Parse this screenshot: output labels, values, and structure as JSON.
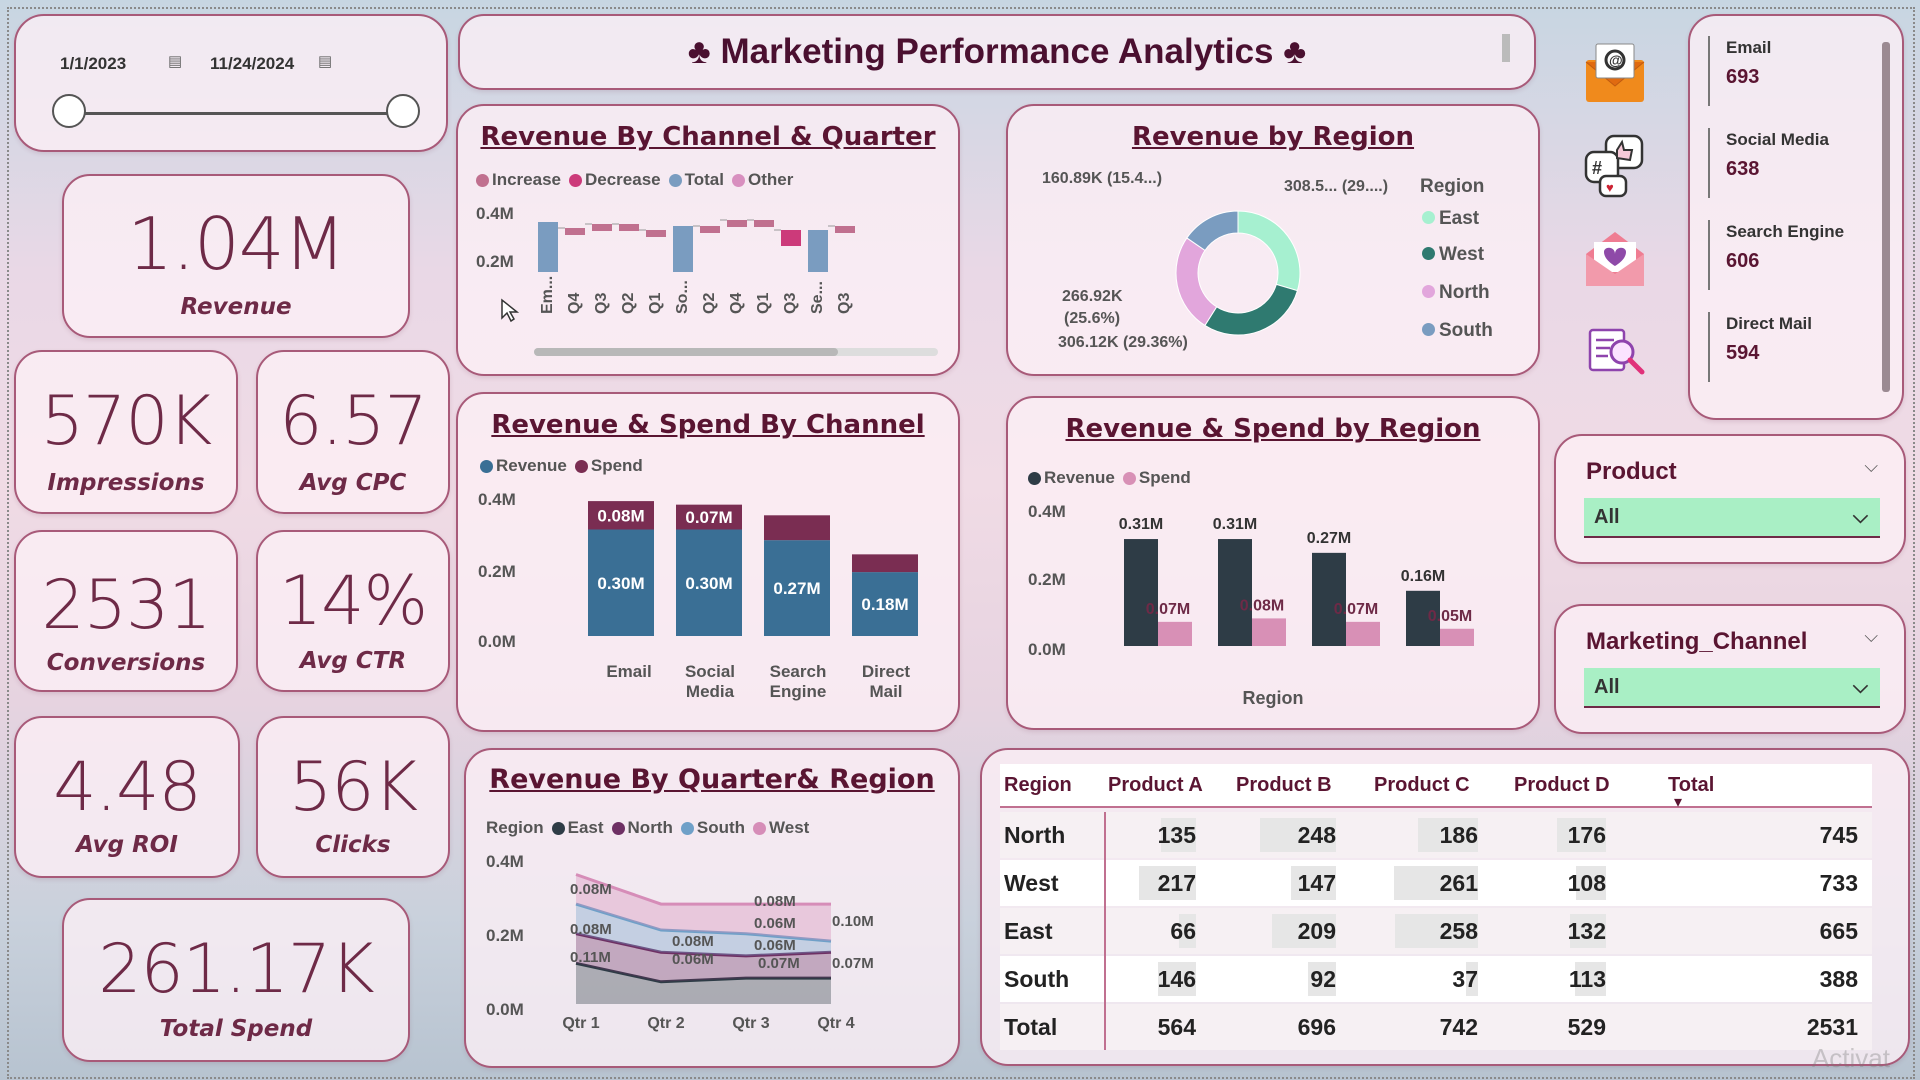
{
  "date_filter": {
    "start": "1/1/2023",
    "end": "11/24/2024"
  },
  "header": {
    "title": "♣ Marketing Performance Analytics ♣"
  },
  "kpis": {
    "revenue": {
      "value": "1.04M",
      "label": "Revenue"
    },
    "impressions": {
      "value": "570K",
      "label": "Impressions"
    },
    "avg_cpc": {
      "value": "6.57",
      "label": "Avg CPC"
    },
    "conversions": {
      "value": "2531",
      "label": "Conversions"
    },
    "avg_ctr": {
      "value": "14%",
      "label": "Avg CTR"
    },
    "avg_roi": {
      "value": "4.48",
      "label": "Avg ROI"
    },
    "clicks": {
      "value": "56K",
      "label": "Clicks"
    },
    "total_spend": {
      "value": "261.17K",
      "label": "Total Spend"
    }
  },
  "channel_counts": [
    {
      "label": "Email",
      "value": "693"
    },
    {
      "label": "Social Media",
      "value": "638"
    },
    {
      "label": "Search Engine",
      "value": "606"
    },
    {
      "label": "Direct Mail",
      "value": "594"
    }
  ],
  "icons": [
    "email-icon",
    "social-media-icon",
    "love-mail-icon",
    "search-analytics-icon"
  ],
  "filters": {
    "product": {
      "label": "Product",
      "value": "All"
    },
    "channel": {
      "label": "Marketing_Channel",
      "value": "All"
    }
  },
  "colors": {
    "revenue": "#3a6f95",
    "spend": "#7a2d52",
    "east": "#a6f0d0",
    "west": "#2f7a70",
    "north": "#e2a6dc",
    "south": "#7a9cc0",
    "increase": "#c0708f",
    "decrease": "#cc3a7a",
    "total": "#7a9cc0",
    "other": "#d88fbf",
    "qr_east": "#2e3c46",
    "qr_north": "#6e3064",
    "qr_south": "#6fa0c8",
    "qr_west": "#d68db8"
  },
  "chart_data": [
    {
      "type": "bar",
      "title": "Revenue By Channel & Quarter",
      "legend": [
        "Increase",
        "Decrease",
        "Total",
        "Other"
      ],
      "categories": [
        "Em...",
        "Q4",
        "Q3",
        "Q2",
        "Q1",
        "So...",
        "Q2",
        "Q4",
        "Q1",
        "Q3",
        "Se...",
        "Q3"
      ],
      "series_kind": [
        "Total",
        "Other",
        "Other",
        "Other",
        "Other",
        "Total",
        "Other",
        "Other",
        "Other",
        "Other",
        "Total",
        "Other"
      ],
      "y_ticks": [
        "0.4M",
        "0.2M"
      ],
      "ylim": [
        0,
        0.4
      ]
    },
    {
      "type": "pie",
      "title": "Revenue by Region",
      "legend_title": "Region",
      "categories": [
        "East",
        "West",
        "North",
        "South"
      ],
      "values": [
        308.5,
        306.12,
        266.92,
        160.89
      ],
      "labels": [
        "308.5... (29....)",
        "306.12K (29.36%)",
        "266.92K",
        "(25.6%)",
        "160.89K (15.4...)"
      ]
    },
    {
      "type": "bar",
      "title": "Revenue & Spend By Channel",
      "categories": [
        "Email",
        "Social Media",
        "Search Engine",
        "Direct Mail"
      ],
      "series": [
        {
          "name": "Revenue",
          "values": [
            0.3,
            0.3,
            0.27,
            0.18
          ]
        },
        {
          "name": "Spend",
          "values": [
            0.08,
            0.07,
            0.07,
            0.05
          ]
        }
      ],
      "data_labels": {
        "revenue": [
          "0.30M",
          "0.30M",
          "0.27M",
          "0.18M"
        ],
        "spend": [
          "0.08M",
          "0.07M",
          "",
          ""
        ]
      },
      "y_ticks": [
        "0.4M",
        "0.2M",
        "0.0M"
      ],
      "ylim": [
        0,
        0.4
      ],
      "stacked": true
    },
    {
      "type": "bar",
      "title": "Revenue & Spend by Region",
      "xlabel": "Region",
      "categories": [
        "East",
        "West",
        "North",
        "South"
      ],
      "series": [
        {
          "name": "Revenue",
          "values": [
            0.31,
            0.31,
            0.27,
            0.16
          ]
        },
        {
          "name": "Spend",
          "values": [
            0.07,
            0.08,
            0.07,
            0.05
          ]
        }
      ],
      "data_labels": {
        "revenue": [
          "0.31M",
          "0.31M",
          "0.27M",
          "0.16M"
        ],
        "spend": [
          "0.07M",
          "0.08M",
          "0.07M",
          "0.05M"
        ]
      },
      "y_ticks": [
        "0.4M",
        "0.2M",
        "0.0M"
      ],
      "ylim": [
        0,
        0.4
      ]
    },
    {
      "type": "area",
      "title": "Revenue By Quarter& Region",
      "legend_title": "Region",
      "x": [
        "Qtr 1",
        "Qtr 2",
        "Qtr 3",
        "Qtr 4"
      ],
      "series": [
        {
          "name": "East",
          "values": [
            0.11,
            0.06,
            0.07,
            0.07
          ]
        },
        {
          "name": "North",
          "values": [
            0.08,
            0.08,
            0.06,
            0.07
          ]
        },
        {
          "name": "South",
          "values": [
            0.08,
            0.06,
            0.06,
            0.03
          ]
        },
        {
          "name": "West",
          "values": [
            0.08,
            0.07,
            0.08,
            0.1
          ]
        }
      ],
      "annotations": [
        "0.08M",
        "0.08M",
        "0.11M",
        "0.08M",
        "0.06M",
        "0.08M",
        "0.06M",
        "0.06M",
        "0.07M",
        "0.10M",
        "0.07M"
      ],
      "y_ticks": [
        "0.4M",
        "0.2M",
        "0.0M"
      ],
      "ylim": [
        0,
        0.4
      ],
      "stacked": true
    },
    {
      "type": "table",
      "columns": [
        "Region",
        "Product A",
        "Product B",
        "Product C",
        "Product D",
        "Total"
      ],
      "rows": [
        [
          "North",
          "135",
          "248",
          "186",
          "176",
          "745"
        ],
        [
          "West",
          "217",
          "147",
          "261",
          "108",
          "733"
        ],
        [
          "East",
          "66",
          "209",
          "258",
          "132",
          "665"
        ],
        [
          "South",
          "146",
          "92",
          "37",
          "113",
          "388"
        ],
        [
          "Total",
          "564",
          "696",
          "742",
          "529",
          "2531"
        ]
      ]
    }
  ],
  "watermark": "Activat"
}
